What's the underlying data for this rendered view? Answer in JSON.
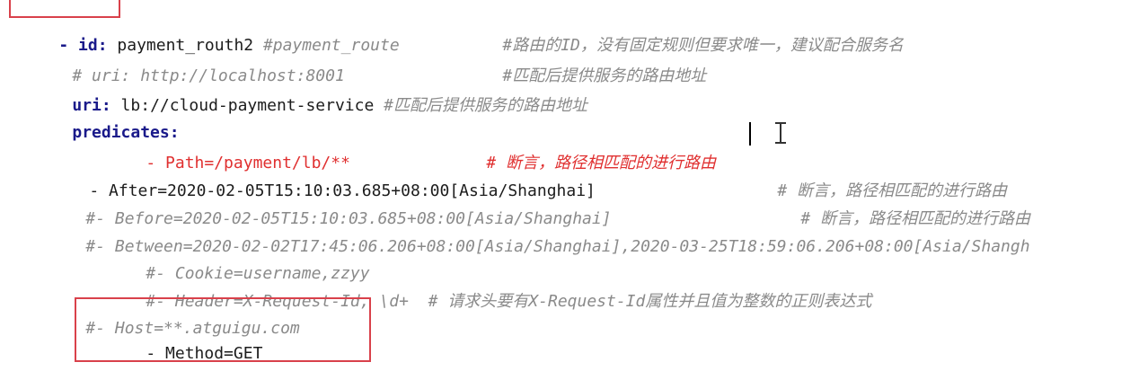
{
  "editor": {
    "lines": [
      {
        "dash": "- ",
        "key": "id:",
        "value": " payment_routh2 ",
        "inline_comment": "#payment_route",
        "comment": "#路由的ID，没有固定规则但要求唯一，建议配合服务名"
      },
      {
        "text": "# uri: http://localhost:8001",
        "comment": "#匹配后提供服务的路由地址"
      },
      {
        "key": "uri:",
        "value": " lb://cloud-payment-service ",
        "comment": "#匹配后提供服务的路由地址"
      },
      {
        "key": "predicates:"
      },
      {
        "text": "- Path=/payment/lb/**",
        "comment": "# 断言，路径相匹配的进行路由"
      },
      {
        "text": "- After=2020-02-05T15:10:03.685+08:00[Asia/Shanghai]",
        "comment": "# 断言，路径相匹配的进行路由"
      },
      {
        "text": "#- Before=2020-02-05T15:10:03.685+08:00[Asia/Shanghai]",
        "comment": "# 断言，路径相匹配的进行路由"
      },
      {
        "text": "#- Between=2020-02-02T17:45:06.206+08:00[Asia/Shanghai],2020-03-25T18:59:06.206+08:00[Asia/Shangh"
      },
      {
        "text": "#- Cookie=username,zzyy"
      },
      {
        "text": "#- Header=X-Request-Id, \\d+  # 请求头要有X-Request-Id属性并且值为整数的正则表达式"
      },
      {
        "text": "#- Host=**.atguigu.com"
      },
      {
        "text": "- Method=GET"
      }
    ]
  }
}
